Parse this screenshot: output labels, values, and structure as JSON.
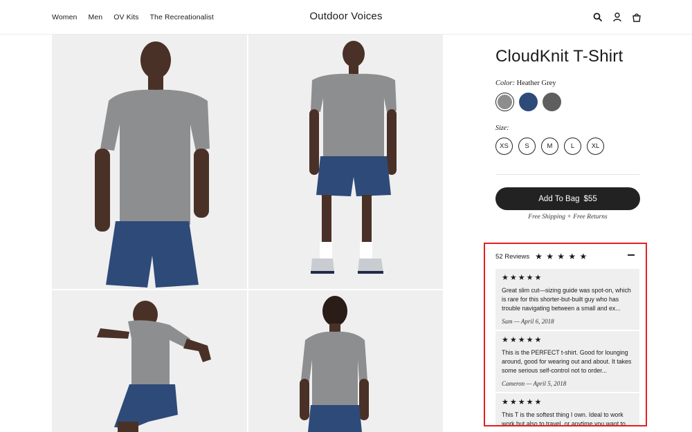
{
  "header": {
    "nav": [
      "Women",
      "Men",
      "OV Kits",
      "The Recreationalist"
    ],
    "brand": "Outdoor Voices",
    "icons": [
      "search-icon",
      "account-icon",
      "bag-icon"
    ]
  },
  "gallery": {
    "images": [
      "model-front-image",
      "model-full-body-image",
      "model-jumping-image",
      "model-back-image"
    ]
  },
  "product": {
    "title": "CloudKnit T-Shirt",
    "color_label": "Color:",
    "color_value": "Heather Grey",
    "colors": [
      "#8c8c8c",
      "#2e4a78",
      "#5e5e5e"
    ],
    "size_label": "Size:",
    "sizes": [
      "XS",
      "S",
      "M",
      "L",
      "XL"
    ],
    "add_to_bag_label": "Add To Bag",
    "price": "$55",
    "shipping_note": "Free Shipping + Free Returns"
  },
  "reviews": {
    "count_label": "52 Reviews",
    "rating_stars": "★ ★ ★ ★ ★",
    "items": [
      {
        "stars": "★★★★★",
        "text": "Great slim cut—sizing guide was spot-on, which is rare for this shorter-but-built guy who has trouble navigating between a small and ex...",
        "meta": "Sam — April 6, 2018"
      },
      {
        "stars": "★★★★★",
        "text": "This is the PERFECT t-shirt. Good for lounging around, good for wearing out and about. It takes some serious self-control not to order...",
        "meta": "Cameron — April 5, 2018"
      },
      {
        "stars": "★★★★★",
        "text": "This T is the softest thing I own. Ideal to work work but also to travel, or anytime you want to",
        "meta": ""
      }
    ]
  },
  "colors": {
    "accent_outline": "#e41e1e",
    "button": "#222222",
    "tile_bg": "#efefef"
  }
}
